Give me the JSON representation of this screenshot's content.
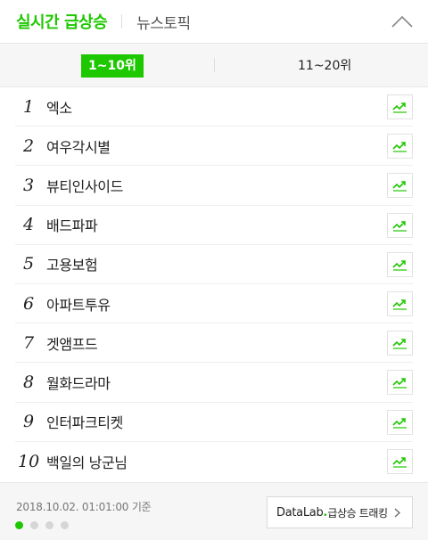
{
  "header": {
    "tab_main": "실시간 급상승",
    "tab_sub": "뉴스토픽"
  },
  "pagebar": {
    "active": "1~10위",
    "inactive": "11~20위"
  },
  "ranks": [
    {
      "rank": "1",
      "keyword": "엑소"
    },
    {
      "rank": "2",
      "keyword": "여우각시별"
    },
    {
      "rank": "3",
      "keyword": "뷰티인사이드"
    },
    {
      "rank": "4",
      "keyword": "배드파파"
    },
    {
      "rank": "5",
      "keyword": "고용보험"
    },
    {
      "rank": "6",
      "keyword": "아파트투유"
    },
    {
      "rank": "7",
      "keyword": "겟앰프드"
    },
    {
      "rank": "8",
      "keyword": "월화드라마"
    },
    {
      "rank": "9",
      "keyword": "인터파크티켓"
    },
    {
      "rank": "10",
      "keyword": "백일의 낭군님"
    }
  ],
  "footer": {
    "timestamp": "2018.10.02. 01:01:00 기준",
    "datalab_brand": "DataLab",
    "datalab_dot": ".",
    "datalab_label": "급상승 트래킹",
    "page_dots": 4,
    "active_dot": 1
  },
  "colors": {
    "accent": "#1ec800"
  },
  "icons": {
    "collapse": "chevron-up-icon",
    "trend": "trend-chart-icon",
    "datalab_arrow": "chevron-right-icon"
  }
}
